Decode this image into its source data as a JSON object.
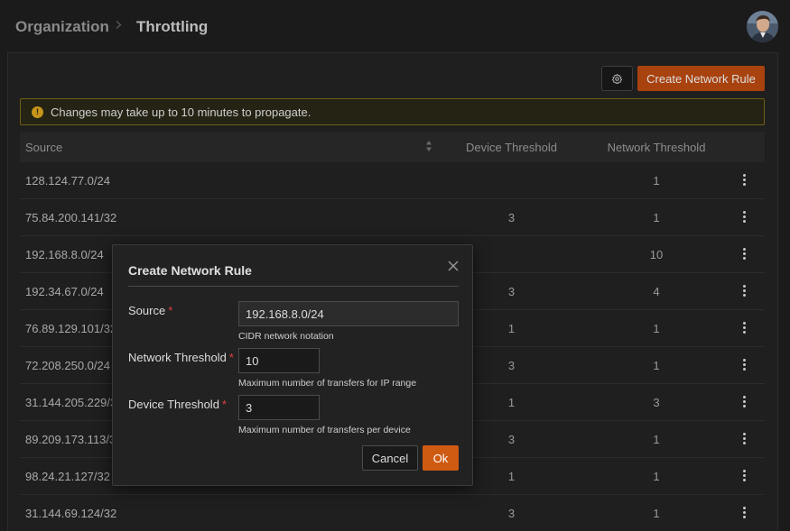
{
  "breadcrumb": {
    "root": "Organization",
    "current": "Throttling"
  },
  "toolbar": {
    "create_label": "Create Network Rule"
  },
  "banner": {
    "text": "Changes may take up to 10 minutes to propagate.",
    "icon": "warning-icon",
    "color": "#c7951a"
  },
  "table": {
    "columns": [
      "Source",
      "Device Threshold",
      "Network Threshold"
    ],
    "rows": [
      {
        "source": "128.124.77.0/24",
        "device": "",
        "network": "1"
      },
      {
        "source": "75.84.200.141/32",
        "device": "3",
        "network": "1"
      },
      {
        "source": "192.168.8.0/24",
        "device": "",
        "network": "10"
      },
      {
        "source": "192.34.67.0/24",
        "device": "3",
        "network": "4"
      },
      {
        "source": "76.89.129.101/32",
        "device": "1",
        "network": "1"
      },
      {
        "source": "72.208.250.0/24",
        "device": "3",
        "network": "1"
      },
      {
        "source": "31.144.205.229/32",
        "device": "1",
        "network": "3"
      },
      {
        "source": "89.209.173.113/32",
        "device": "3",
        "network": "1"
      },
      {
        "source": "98.24.21.127/32",
        "device": "1",
        "network": "1"
      },
      {
        "source": "31.144.69.124/32",
        "device": "3",
        "network": "1"
      }
    ]
  },
  "modal": {
    "title": "Create Network Rule",
    "source": {
      "label": "Source",
      "required_mark": "*",
      "value": "192.168.8.0/24",
      "help": "CIDR network notation"
    },
    "network_threshold": {
      "label": "Network Threshold",
      "required_mark": "*",
      "value": "10",
      "help": "Maximum number of transfers for IP range"
    },
    "device_threshold": {
      "label": "Device Threshold",
      "required_mark": "*",
      "value": "3",
      "help": "Maximum number of transfers per device"
    },
    "cancel_label": "Cancel",
    "ok_label": "Ok"
  },
  "colors": {
    "accent": "#cf5a12",
    "create_button": "#a8420f",
    "required": "#e04040"
  }
}
